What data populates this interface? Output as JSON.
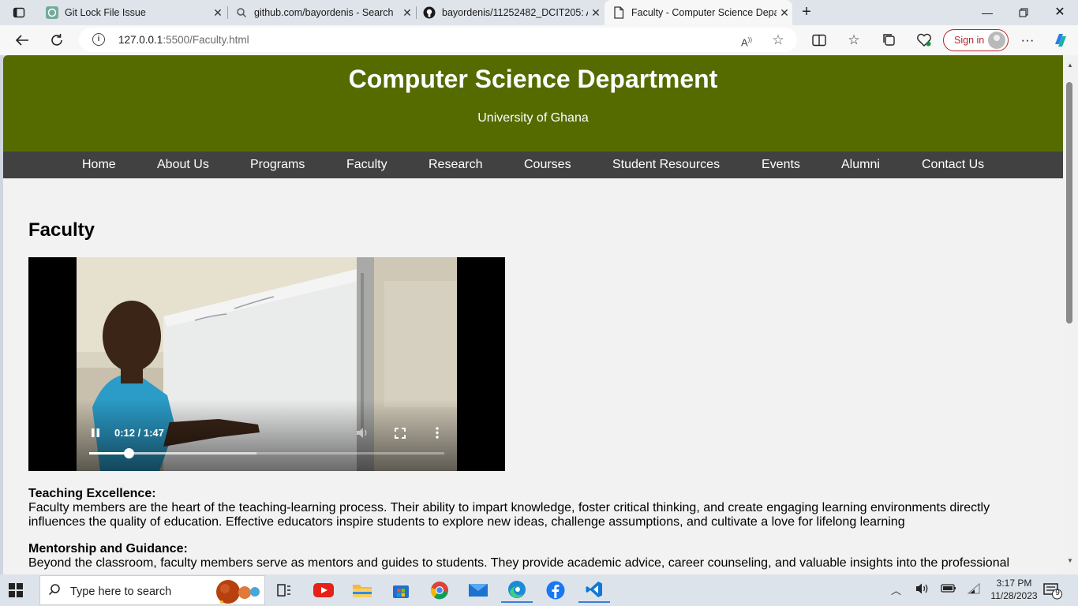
{
  "browser": {
    "tabs": [
      {
        "label": "Git Lock File Issue",
        "icon": "chatgpt-icon"
      },
      {
        "label": "github.com/bayordenis - Search",
        "icon": "search-icon"
      },
      {
        "label": "bayordenis/11252482_DCIT205: A",
        "icon": "github-icon"
      },
      {
        "label": "Faculty - Computer Science Depa",
        "icon": "page-icon",
        "active": true
      }
    ],
    "url_host": "127.0.0.1",
    "url_path": ":5500/Faculty.html",
    "signin_label": "Sign in"
  },
  "site": {
    "title": "Computer Science Department",
    "subtitle": "University of Ghana",
    "nav": [
      "Home",
      "About Us",
      "Programs",
      "Faculty",
      "Research",
      "Courses",
      "Student Resources",
      "Events",
      "Alumni",
      "Contact Us"
    ],
    "header_color": "#556b00",
    "nav_color": "#414141"
  },
  "page": {
    "heading": "Faculty",
    "video": {
      "time": "0:12 / 1:47",
      "played_fraction": 0.112,
      "buffered_fraction": 0.47
    },
    "sections": [
      {
        "title": "Teaching Excellence:",
        "body": "Faculty members are the heart of the teaching-learning process. Their ability to impart knowledge, foster critical thinking, and create engaging learning environments directly influences the quality of education. Effective educators inspire students to explore new ideas, challenge assumptions, and cultivate a love for lifelong learning"
      },
      {
        "title": "Mentorship and Guidance:",
        "body": "Beyond the classroom, faculty members serve as mentors and guides to students. They provide academic advice, career counseling, and valuable insights into the professional"
      }
    ]
  },
  "taskbar": {
    "search_placeholder": "Type here to search",
    "time": "3:17 PM",
    "date": "11/28/2023",
    "notification_count": "9"
  }
}
